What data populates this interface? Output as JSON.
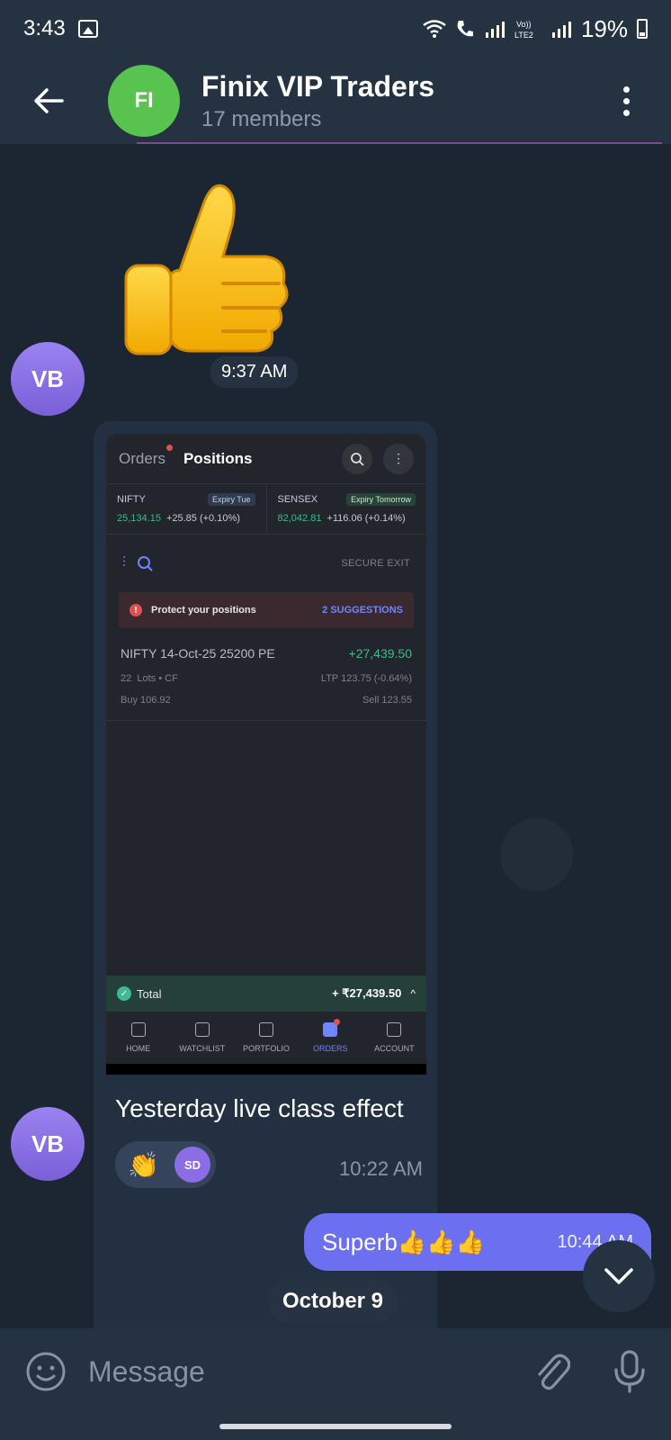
{
  "status": {
    "time": "3:43",
    "battery": "19%"
  },
  "header": {
    "avatar": "FI",
    "title": "Finix VIP Traders",
    "subtitle": "17 members"
  },
  "messages": {
    "sticker_time": "9:37 AM",
    "sender_avatar": "VB",
    "photo": {
      "screenshot": {
        "tabs": [
          "Orders",
          "Positions"
        ],
        "indices": [
          {
            "name": "NIFTY",
            "tag": "Expiry Tue",
            "value": "25,134.15",
            "change": "+25.85 (+0.10%)"
          },
          {
            "name": "SENSEX",
            "tag": "Expiry Tomorrow",
            "value": "82,042.81",
            "change": "+116.06 (+0.14%)"
          }
        ],
        "secure_exit": "SECURE EXIT",
        "protect": {
          "text": "Protect your positions",
          "link": "2 SUGGESTIONS"
        },
        "position": {
          "name": "NIFTY 14-Oct-25 25200 PE",
          "pnl": "+27,439.50",
          "lots": "22",
          "lots_label": "Lots",
          "product": "CF",
          "ltp": "LTP 123.75 (-0.64%)",
          "buy": "Buy 106.92",
          "sell": "Sell 123.55"
        },
        "total": {
          "label": "Total",
          "value": "+ ₹27,439.50"
        },
        "nav": [
          "HOME",
          "WATCHLIST",
          "PORTFOLIO",
          "ORDERS",
          "ACCOUNT"
        ]
      },
      "caption": "Yesterday live class effect",
      "reaction": {
        "emoji": "👏",
        "avatar": "SD"
      },
      "time": "10:22 AM"
    },
    "outgoing": {
      "text": "Superb👍👍👍",
      "time": "10:44 AM"
    },
    "date_divider": "October 9"
  },
  "composer": {
    "placeholder": "Message"
  },
  "icons": [
    "image-icon",
    "wifi-icon",
    "signal-icon",
    "battery-icon",
    "back-arrow-icon",
    "more-vert-icon",
    "thumbs-up-sticker-icon",
    "search-icon",
    "filter-icon",
    "chevron-down-icon",
    "emoji-icon",
    "attach-icon",
    "mic-icon"
  ]
}
